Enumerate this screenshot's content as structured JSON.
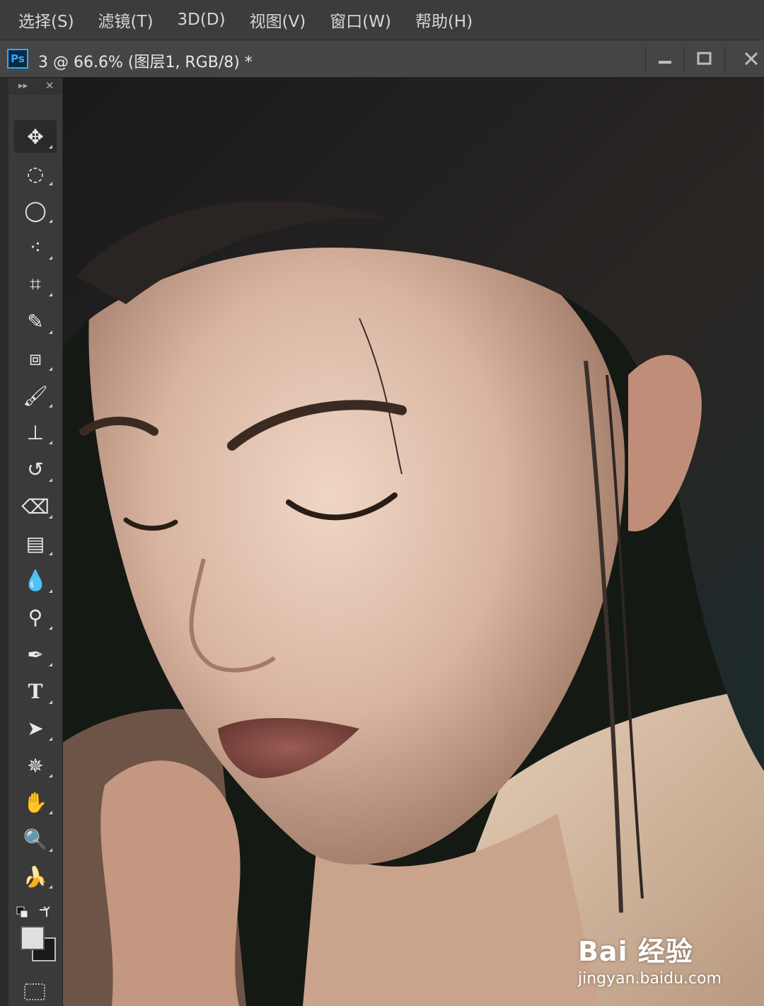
{
  "menubar": {
    "items": [
      "选择(S)",
      "滤镜(T)",
      "3D(D)",
      "视图(V)",
      "窗口(W)",
      "帮助(H)"
    ]
  },
  "document": {
    "app_badge": "Ps",
    "title": "3 @ 66.6% (图层1, RGB/8) *",
    "minimize_icon": "minimize-icon",
    "maximize_icon": "maximize-icon",
    "close_icon": "close-icon"
  },
  "toolbox": {
    "header": {
      "expand": "▸▸",
      "close": "✕"
    },
    "tools": [
      {
        "name": "move-tool",
        "glyph": "✥",
        "active": true
      },
      {
        "name": "elliptical-marquee-tool",
        "glyph": "◌"
      },
      {
        "name": "lasso-tool",
        "glyph": "◯"
      },
      {
        "name": "quick-selection-tool",
        "glyph": "⁖"
      },
      {
        "name": "crop-tool",
        "glyph": "⌗"
      },
      {
        "name": "eyedropper-tool",
        "glyph": "✎"
      },
      {
        "name": "patch-tool",
        "glyph": "⧈"
      },
      {
        "name": "brush-tool",
        "glyph": "🖌"
      },
      {
        "name": "clone-stamp-tool",
        "glyph": "⊥"
      },
      {
        "name": "history-brush-tool",
        "glyph": "↺"
      },
      {
        "name": "eraser-tool",
        "glyph": "⌫"
      },
      {
        "name": "gradient-tool",
        "glyph": "▤"
      },
      {
        "name": "blur-tool",
        "glyph": "💧"
      },
      {
        "name": "dodge-tool",
        "glyph": "⚲"
      },
      {
        "name": "pen-tool",
        "glyph": "✒"
      },
      {
        "name": "type-tool",
        "glyph": "T"
      },
      {
        "name": "path-selection-tool",
        "glyph": "➤"
      },
      {
        "name": "custom-shape-tool",
        "glyph": "✵"
      },
      {
        "name": "hand-tool",
        "glyph": "✋"
      },
      {
        "name": "zoom-tool",
        "glyph": "🔍"
      },
      {
        "name": "extra-tool",
        "glyph": "🍌"
      }
    ],
    "foreground_color": "#e0e0e0",
    "background_color": "#1a1a1a"
  },
  "watermark": {
    "logo": "Bai 经验",
    "url": "jingyan.baidu.com"
  }
}
